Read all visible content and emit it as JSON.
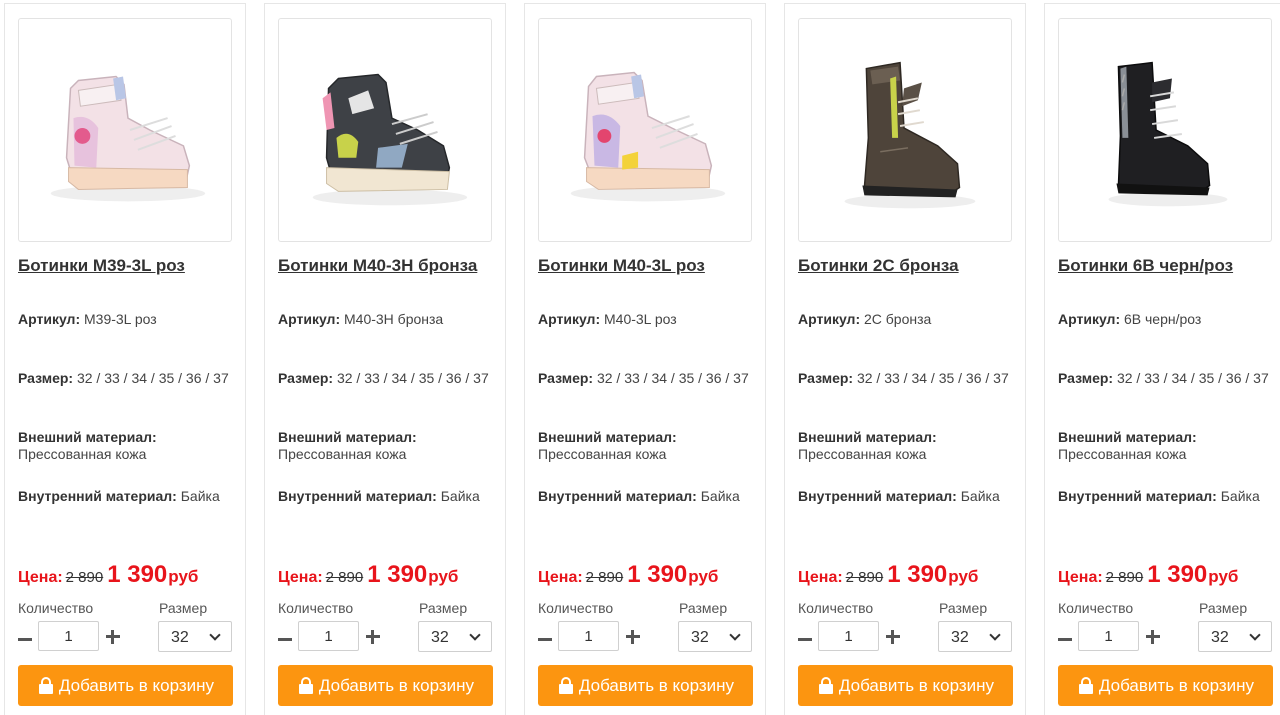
{
  "colors": {
    "price_red": "#e8141b",
    "button_orange": "#fc9510"
  },
  "labels": {
    "article": "Артикул:",
    "size": "Размер:",
    "outer": "Внешний материал:",
    "inner": "Внутренний материал:",
    "price": "Цена:",
    "currency": "руб",
    "qty": "Количество",
    "size_select": "Размер",
    "add_to_cart": "Добавить в корзину"
  },
  "products": [
    {
      "title": "Ботинки М39-3L роз",
      "article": "М39-3L роз",
      "sizes": "32 / 33 / 34 / 35 / 36 / 37",
      "outer": "Прессованная кожа",
      "inner": "Байка",
      "old_price": "2 890",
      "new_price": "1 390",
      "qty": "1",
      "size": "32",
      "image_icon": "pink-sneaker-boot-photo"
    },
    {
      "title": "Ботинки М40-3Н бронза",
      "article": "М40-3Н бронза",
      "sizes": "32 / 33 / 34 / 35 / 36 / 37",
      "outer": "Прессованная кожа",
      "inner": "Байка",
      "old_price": "2 890",
      "new_price": "1 390",
      "qty": "1",
      "size": "32",
      "image_icon": "dark-sneaker-boot-photo"
    },
    {
      "title": "Ботинки М40-3L роз",
      "article": "М40-3L роз",
      "sizes": "32 / 33 / 34 / 35 / 36 / 37",
      "outer": "Прессованная кожа",
      "inner": "Байка",
      "old_price": "2 890",
      "new_price": "1 390",
      "qty": "1",
      "size": "32",
      "image_icon": "pink-sneaker-boot-photo"
    },
    {
      "title": "Ботинки 2С бронза",
      "article": "2С бронза",
      "sizes": "32 / 33 / 34 / 35 / 36 / 37",
      "outer": "Прессованная кожа",
      "inner": "Байка",
      "old_price": "2 890",
      "new_price": "1 390",
      "qty": "1",
      "size": "32",
      "image_icon": "bronze-leather-boot-photo"
    },
    {
      "title": "Ботинки 6В черн/роз",
      "article": "6В черн/роз",
      "sizes": "32 / 33 / 34 / 35 / 36 / 37",
      "outer": "Прессованная кожа",
      "inner": "Байка",
      "old_price": "2 890",
      "new_price": "1 390",
      "qty": "1",
      "size": "32",
      "image_icon": "black-leather-boot-photo"
    }
  ]
}
